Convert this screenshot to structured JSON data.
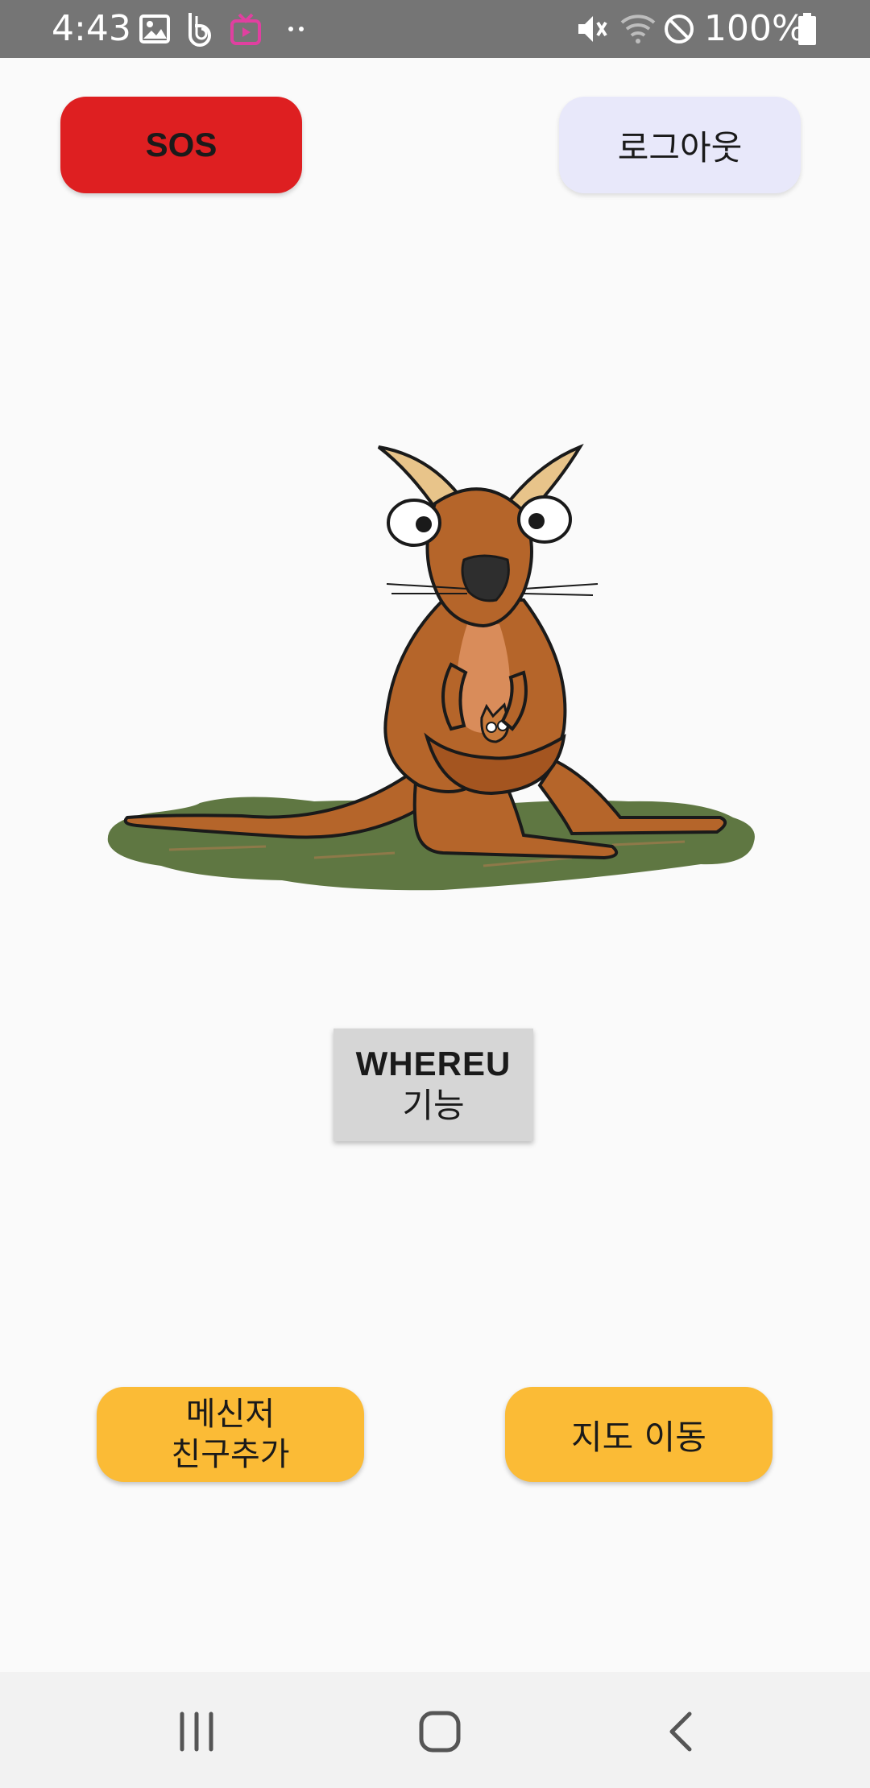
{
  "status_bar": {
    "time": "4:43",
    "battery_percent": "100%",
    "icons": [
      "image-icon",
      "b-app-icon",
      "tv-app-icon",
      "more-dots-icon",
      "mute-icon",
      "wifi-icon",
      "do-not-disturb-icon",
      "battery-icon"
    ]
  },
  "header": {
    "sos_label": "SOS",
    "logout_label": "로그아웃"
  },
  "main": {
    "illustration": "kangaroo-illustration",
    "whereu_line1": "WHEREU",
    "whereu_line2": "기능"
  },
  "footer_buttons": {
    "messenger_line1": "메신저",
    "messenger_line2": "친구추가",
    "map_label": "지도 이동"
  },
  "nav_bar": {
    "icons": [
      "recent-apps-icon",
      "home-icon",
      "back-icon"
    ]
  },
  "colors": {
    "sos": "#de1f21",
    "logout": "#e8e8fa",
    "whereu": "#d6d6d6",
    "accent_yellow": "#fbbb36",
    "status_bar": "#757575"
  }
}
